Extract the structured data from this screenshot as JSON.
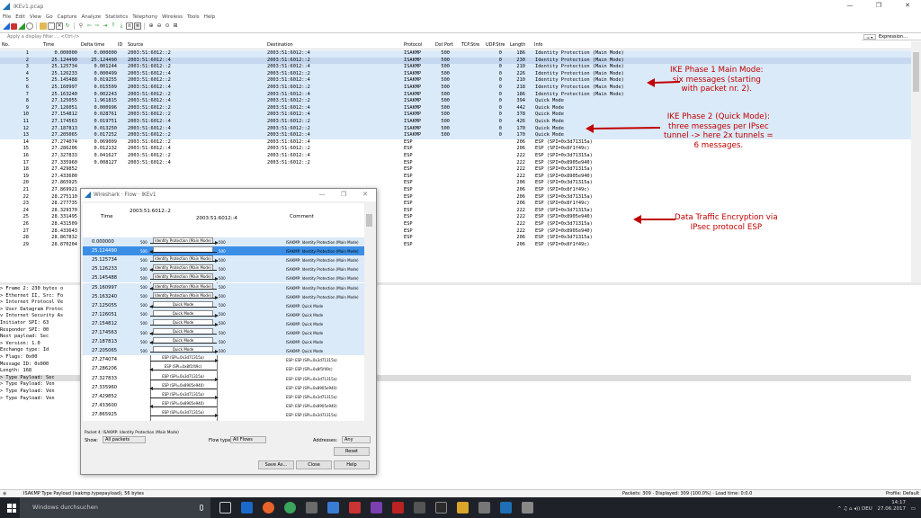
{
  "window": {
    "title": "IKEv1.pcap",
    "minimize": "—",
    "restore": "❐",
    "close": "✕"
  },
  "menu": [
    "File",
    "Edit",
    "View",
    "Go",
    "Capture",
    "Analyze",
    "Statistics",
    "Telephony",
    "Wireless",
    "Tools",
    "Help"
  ],
  "filter": {
    "placeholder": "Apply a display filter … <Ctrl-/>",
    "expression_label": "Expression…"
  },
  "columns": [
    "No.",
    "Time",
    "Delta time",
    "ID",
    "Source",
    "Destination",
    "Protocol",
    "Dst Port",
    "TCP.Stre",
    "UDP.Stre",
    "Length",
    "Info"
  ],
  "packets": [
    {
      "no": "1",
      "time": "0.000000",
      "delta": "0.000000",
      "src": "2003:51:6012::2",
      "dst": "2003:51:6012::4",
      "proto": "ISAKMP",
      "port": "500",
      "udp": "0",
      "len": "186",
      "info": "Identity Protection (Main Mode)"
    },
    {
      "no": "2",
      "time": "25.124490",
      "delta": "25.124490",
      "src": "2003:51:6012::4",
      "dst": "2003:51:6012::2",
      "proto": "ISAKMP",
      "port": "500",
      "udp": "0",
      "len": "230",
      "info": "Identity Protection (Main Mode)"
    },
    {
      "no": "3",
      "time": "25.125734",
      "delta": "0.001244",
      "src": "2003:51:6012::2",
      "dst": "2003:51:6012::4",
      "proto": "ISAKMP",
      "port": "500",
      "udp": "0",
      "len": "210",
      "info": "Identity Protection (Main Mode)"
    },
    {
      "no": "4",
      "time": "25.126233",
      "delta": "0.000499",
      "src": "2003:51:6012::4",
      "dst": "2003:51:6012::2",
      "proto": "ISAKMP",
      "port": "500",
      "udp": "0",
      "len": "226",
      "info": "Identity Protection (Main Mode)"
    },
    {
      "no": "5",
      "time": "25.145488",
      "delta": "0.019255",
      "src": "2003:51:6012::2",
      "dst": "2003:51:6012::4",
      "proto": "ISAKMP",
      "port": "500",
      "udp": "0",
      "len": "210",
      "info": "Identity Protection (Main Mode)"
    },
    {
      "no": "6",
      "time": "25.160997",
      "delta": "0.015509",
      "src": "2003:51:6012::4",
      "dst": "2003:51:6012::2",
      "proto": "ISAKMP",
      "port": "500",
      "udp": "0",
      "len": "218",
      "info": "Identity Protection (Main Mode)"
    },
    {
      "no": "7",
      "time": "25.163240",
      "delta": "0.002243",
      "src": "2003:51:6012::2",
      "dst": "2003:51:6012::4",
      "proto": "ISAKMP",
      "port": "500",
      "udp": "0",
      "len": "186",
      "info": "Identity Protection (Main Mode)"
    },
    {
      "no": "8",
      "time": "27.125055",
      "delta": "1.961815",
      "src": "2003:51:6012::4",
      "dst": "2003:51:6012::2",
      "proto": "ISAKMP",
      "port": "500",
      "udp": "0",
      "len": "394",
      "info": "Quick Mode"
    },
    {
      "no": "9",
      "time": "27.126051",
      "delta": "0.000996",
      "src": "2003:51:6012::2",
      "dst": "2003:51:6012::4",
      "proto": "ISAKMP",
      "port": "500",
      "udp": "0",
      "len": "442",
      "info": "Quick Mode"
    },
    {
      "no": "10",
      "time": "27.154812",
      "delta": "0.028761",
      "src": "2003:51:6012::2",
      "dst": "2003:51:6012::4",
      "proto": "ISAKMP",
      "port": "500",
      "udp": "0",
      "len": "378",
      "info": "Quick Mode"
    },
    {
      "no": "11",
      "time": "27.174563",
      "delta": "0.019751",
      "src": "2003:51:6012::4",
      "dst": "2003:51:6012::2",
      "proto": "ISAKMP",
      "port": "500",
      "udp": "0",
      "len": "426",
      "info": "Quick Mode"
    },
    {
      "no": "12",
      "time": "27.187813",
      "delta": "0.013250",
      "src": "2003:51:6012::4",
      "dst": "2003:51:6012::2",
      "proto": "ISAKMP",
      "port": "500",
      "udp": "0",
      "len": "170",
      "info": "Quick Mode"
    },
    {
      "no": "13",
      "time": "27.205065",
      "delta": "0.017252",
      "src": "2003:51:6012::2",
      "dst": "2003:51:6012::4",
      "proto": "ISAKMP",
      "port": "500",
      "udp": "0",
      "len": "170",
      "info": "Quick Mode"
    },
    {
      "no": "14",
      "time": "27.274074",
      "delta": "0.069009",
      "src": "2003:51:6012::2",
      "dst": "2003:51:6012::4",
      "proto": "ESP",
      "port": "",
      "udp": "",
      "len": "206",
      "info": "ESP (SPI=0x3d71315a)"
    },
    {
      "no": "15",
      "time": "27.286206",
      "delta": "0.012132",
      "src": "2003:51:6012::4",
      "dst": "2003:51:6012::2",
      "proto": "ESP",
      "port": "",
      "udp": "",
      "len": "206",
      "info": "ESP (SPI=0x8f1f49c)"
    },
    {
      "no": "16",
      "time": "27.327833",
      "delta": "0.041627",
      "src": "2003:51:6012::2",
      "dst": "2003:51:6012::4",
      "proto": "ESP",
      "port": "",
      "udp": "",
      "len": "222",
      "info": "ESP (SPI=0x3d71315a)"
    },
    {
      "no": "17",
      "time": "27.335960",
      "delta": "0.008127",
      "src": "2003:51:6012::4",
      "dst": "2003:51:6012::2",
      "proto": "ESP",
      "port": "",
      "udp": "",
      "len": "222",
      "info": "ESP (SPI=0x8905e940)"
    },
    {
      "no": "18",
      "time": "27.429852",
      "delta": "",
      "src": "",
      "dst": "",
      "proto": "ESP",
      "port": "",
      "udp": "",
      "len": "222",
      "info": "ESP (SPI=0x3d71315a)"
    },
    {
      "no": "19",
      "time": "27.433600",
      "delta": "",
      "src": "",
      "dst": "",
      "proto": "ESP",
      "port": "",
      "udp": "",
      "len": "222",
      "info": "ESP (SPI=0x8905e940)"
    },
    {
      "no": "20",
      "time": "27.865925",
      "delta": "",
      "src": "",
      "dst": "",
      "proto": "ESP",
      "port": "",
      "udp": "",
      "len": "206",
      "info": "ESP (SPI=0x3d71315a)"
    },
    {
      "no": "21",
      "time": "27.869921",
      "delta": "",
      "src": "",
      "dst": "",
      "proto": "ESP",
      "port": "",
      "udp": "",
      "len": "206",
      "info": "ESP (SPI=0x8f1f49c)"
    },
    {
      "no": "22",
      "time": "28.275110",
      "delta": "",
      "src": "",
      "dst": "",
      "proto": "ESP",
      "port": "",
      "udp": "",
      "len": "206",
      "info": "ESP (SPI=0x3d71315a)"
    },
    {
      "no": "23",
      "time": "28.277735",
      "delta": "",
      "src": "",
      "dst": "",
      "proto": "ESP",
      "port": "",
      "udp": "",
      "len": "206",
      "info": "ESP (SPI=0x8f1f49c)"
    },
    {
      "no": "24",
      "time": "28.329370",
      "delta": "",
      "src": "",
      "dst": "",
      "proto": "ESP",
      "port": "",
      "udp": "",
      "len": "222",
      "info": "ESP (SPI=0x3d71315a)"
    },
    {
      "no": "25",
      "time": "28.331495",
      "delta": "",
      "src": "",
      "dst": "",
      "proto": "ESP",
      "port": "",
      "udp": "",
      "len": "222",
      "info": "ESP (SPI=0x8905e940)"
    },
    {
      "no": "26",
      "time": "28.431509",
      "delta": "",
      "src": "",
      "dst": "",
      "proto": "ESP",
      "port": "",
      "udp": "",
      "len": "222",
      "info": "ESP (SPI=0x3d71315a)"
    },
    {
      "no": "27",
      "time": "28.433643",
      "delta": "",
      "src": "",
      "dst": "",
      "proto": "ESP",
      "port": "",
      "udp": "",
      "len": "222",
      "info": "ESP (SPI=0x8905e940)"
    },
    {
      "no": "28",
      "time": "28.867832",
      "delta": "",
      "src": "",
      "dst": "",
      "proto": "ESP",
      "port": "",
      "udp": "",
      "len": "206",
      "info": "ESP (SPI=0x3d71315a)"
    },
    {
      "no": "29",
      "time": "28.870204",
      "delta": "",
      "src": "",
      "dst": "",
      "proto": "ESP",
      "port": "",
      "udp": "",
      "len": "206",
      "info": "ESP (SPI=0x8f1f49c)"
    }
  ],
  "details": [
    {
      "text": "> Frame 2: 230 bytes o",
      "hl": false
    },
    {
      "text": "> Ethernet II, Src: Fo",
      "hl": false
    },
    {
      "text": "> Internet Protocol Ve",
      "hl": false
    },
    {
      "text": "> User Datagram Protoc",
      "hl": false
    },
    {
      "text": "v Internet Security As",
      "hl": false
    },
    {
      "text": "    Initiator SPI: 63",
      "hl": false
    },
    {
      "text": "    Responder SPI: 00",
      "hl": false
    },
    {
      "text": "    Next payload: Sec",
      "hl": false
    },
    {
      "text": "  > Version: 1.0",
      "hl": false
    },
    {
      "text": "    Exchange type: Id",
      "hl": false
    },
    {
      "text": "  > Flags: 0x00",
      "hl": false
    },
    {
      "text": "    Message ID: 0x000",
      "hl": false
    },
    {
      "text": "    Length: 168",
      "hl": false
    },
    {
      "text": "  > Type Payload: Sec",
      "hl": true
    },
    {
      "text": "  > Type Payload: Ven",
      "hl": false
    },
    {
      "text": "  > Type Payload: Ven",
      "hl": false
    },
    {
      "text": "  > Type Payload: Ven",
      "hl": false
    }
  ],
  "annotations": {
    "phase1": "IKE Phase 1 Main Mode:\nsix messages (starting\nwith packet nr. 2).",
    "phase2": "IKE Phase 2 (Quick Mode):\nthree messages per IPsec\ntunnel -> here 2x tunnels =\n6 messages.",
    "esp": "Data Traffic Encryption via\nIPsec protocol ESP"
  },
  "flow": {
    "title": "Wireshark · Flow · IKEv1",
    "col_time": "Time",
    "host_a": "2003:51:6012::2",
    "host_b": "2003:51:6012::4",
    "col_comment": "Comment",
    "rows": [
      {
        "time": "0.000000",
        "label": "Identity Protection (Main Mode)",
        "dir": "r",
        "comment": "ISAKMP: Identity Protection (Main Mode)",
        "kind": "isa"
      },
      {
        "time": "25.124490",
        "label": "Identity Protection (Main Mode)",
        "dir": "l",
        "comment": "ISAKMP: Identity Protection (Main Mode)",
        "kind": "sel"
      },
      {
        "time": "25.125734",
        "label": "Identity Protection (Main Mode)",
        "dir": "r",
        "comment": "ISAKMP: Identity Protection (Main Mode)",
        "kind": "isa"
      },
      {
        "time": "25.126233",
        "label": "Identity Protection (Main Mode)",
        "dir": "l",
        "comment": "ISAKMP: Identity Protection (Main Mode)",
        "kind": "isa"
      },
      {
        "time": "25.145488",
        "label": "Identity Protection (Main Mode)",
        "dir": "r",
        "comment": "ISAKMP: Identity Protection (Main Mode)",
        "kind": "isa"
      },
      {
        "time": "25.160997",
        "label": "Identity Protection (Main Mode)",
        "dir": "l",
        "comment": "ISAKMP: Identity Protection (Main Mode)",
        "kind": "isa"
      },
      {
        "time": "25.163240",
        "label": "Identity Protection (Main Mode)",
        "dir": "r",
        "comment": "ISAKMP: Identity Protection (Main Mode)",
        "kind": "isa"
      },
      {
        "time": "27.125055",
        "label": "Quick Mode",
        "dir": "l",
        "comment": "ISAKMP: Quick Mode",
        "kind": "isa"
      },
      {
        "time": "27.126051",
        "label": "Quick Mode",
        "dir": "r",
        "comment": "ISAKMP: Quick Mode",
        "kind": "isa"
      },
      {
        "time": "27.154812",
        "label": "Quick Mode",
        "dir": "r",
        "comment": "ISAKMP: Quick Mode",
        "kind": "isa"
      },
      {
        "time": "27.174563",
        "label": "Quick Mode",
        "dir": "l",
        "comment": "ISAKMP: Quick Mode",
        "kind": "isa"
      },
      {
        "time": "27.187813",
        "label": "Quick Mode",
        "dir": "l",
        "comment": "ISAKMP: Quick Mode",
        "kind": "isa"
      },
      {
        "time": "27.205065",
        "label": "Quick Mode",
        "dir": "r",
        "comment": "ISAKMP: Quick Mode",
        "kind": "isa"
      },
      {
        "time": "27.274074",
        "label": "ESP (SPI=0x3d71315a)",
        "dir": "r",
        "comment": "ESP: ESP (SPI=0x3d71315a)",
        "kind": "esp"
      },
      {
        "time": "27.286206",
        "label": "ESP (SPI=0x8f1f49c)",
        "dir": "l",
        "comment": "ESP: ESP (SPI=0x8f1f49c)",
        "kind": "esp"
      },
      {
        "time": "27.327833",
        "label": "ESP (SPI=0x3d71315a)",
        "dir": "r",
        "comment": "ESP: ESP (SPI=0x3d71315a)",
        "kind": "esp"
      },
      {
        "time": "27.335960",
        "label": "ESP (SPI=0x8905e940)",
        "dir": "l",
        "comment": "ESP: ESP (SPI=0x8905e940)",
        "kind": "esp"
      },
      {
        "time": "27.429852",
        "label": "ESP (SPI=0x3d71315a)",
        "dir": "r",
        "comment": "ESP: ESP (SPI=0x3d71315a)",
        "kind": "esp"
      },
      {
        "time": "27.433600",
        "label": "ESP (SPI=0x8905e940)",
        "dir": "l",
        "comment": "ESP: ESP (SPI=0x8905e940)",
        "kind": "esp"
      },
      {
        "time": "27.865925",
        "label": "ESP (SPI=0x3d71315a)",
        "dir": "r",
        "comment": "ESP: ESP (SPI=0x3d71315a)",
        "kind": "esp"
      }
    ],
    "packet_info": "Packet 4: ISAKMP: Identity Protection (Main Mode)",
    "show_label": "Show:",
    "show_value": "All packets",
    "flowtype_label": "Flow type:",
    "flowtype_value": "All Flows",
    "addresses_label": "Addresses:",
    "addresses_value": "Any",
    "reset": "Reset",
    "save_as": "Save As...",
    "close": "Close",
    "help": "Help"
  },
  "status": {
    "left": "ISAKMP Type Payload (isakmp.typepayload), 56 bytes",
    "right": "Packets: 309 · Displayed: 309 (100.0%) · Load time: 0:0.0",
    "profile": "Profile: Default"
  },
  "taskbar": {
    "search": "Windows durchsuchen",
    "time": "14:17",
    "date": "27.06.2017",
    "lang": "DEU"
  },
  "colors": {
    "isakmp_row": "#dbeaf9",
    "selected": "#3a8ee6",
    "annotation": "#c00000",
    "taskbar": "#1e2127"
  }
}
